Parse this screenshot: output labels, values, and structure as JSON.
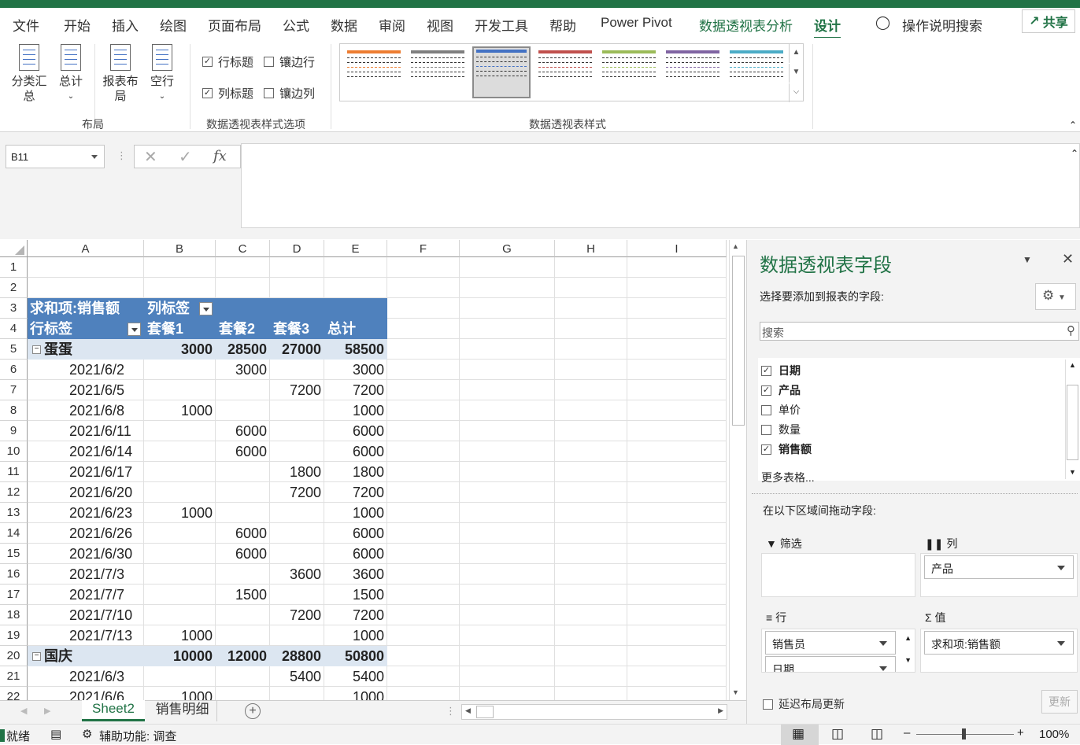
{
  "menu": {
    "tabs": [
      "文件",
      "开始",
      "插入",
      "绘图",
      "页面布局",
      "公式",
      "数据",
      "审阅",
      "视图",
      "开发工具",
      "帮助",
      "Power Pivot",
      "数据透视表分析",
      "设计"
    ],
    "tell_me": "操作说明搜索",
    "share": "共享"
  },
  "ribbon": {
    "subtotal": "分类汇总",
    "grand_total": "总计",
    "report_layout": "报表布局",
    "blank_rows": "空行",
    "group_layout": "布局",
    "row_headers": "行标题",
    "banded_rows": "镶边行",
    "col_headers": "列标题",
    "banded_cols": "镶边列",
    "group_options": "数据透视表样式选项",
    "group_styles": "数据透视表样式",
    "style_colors": [
      "#ed7d31",
      "#7f7f7f",
      "#4472c4",
      "#c0504d",
      "#9bbb59",
      "#8064a2",
      "#4bacc6"
    ]
  },
  "formula_bar": {
    "name_box": "B11",
    "fx": "fx",
    "value": ""
  },
  "grid": {
    "columns": [
      "A",
      "B",
      "C",
      "D",
      "E",
      "F",
      "G",
      "H",
      "I"
    ],
    "header_row": [
      "求和项:销售额",
      "列标签"
    ],
    "label_row": [
      "行标签",
      "套餐1",
      "套餐2",
      "套餐3",
      "总计"
    ],
    "rows": [
      {
        "n": "1",
        "cells": [
          "",
          "",
          "",
          "",
          ""
        ],
        "type": "empty"
      },
      {
        "n": "2",
        "cells": [
          "",
          "",
          "",
          "",
          ""
        ],
        "type": "empty"
      },
      {
        "n": "5",
        "cells": [
          "蛋蛋",
          "3000",
          "28500",
          "27000",
          "58500"
        ],
        "type": "group"
      },
      {
        "n": "6",
        "cells": [
          "2021/6/2",
          "",
          "3000",
          "",
          "3000"
        ],
        "type": "item"
      },
      {
        "n": "7",
        "cells": [
          "2021/6/5",
          "",
          "",
          "7200",
          "7200"
        ],
        "type": "item"
      },
      {
        "n": "8",
        "cells": [
          "2021/6/8",
          "1000",
          "",
          "",
          "1000"
        ],
        "type": "item"
      },
      {
        "n": "9",
        "cells": [
          "2021/6/11",
          "",
          "6000",
          "",
          "6000"
        ],
        "type": "item"
      },
      {
        "n": "10",
        "cells": [
          "2021/6/14",
          "",
          "6000",
          "",
          "6000"
        ],
        "type": "item"
      },
      {
        "n": "11",
        "cells": [
          "2021/6/17",
          "",
          "",
          "1800",
          "1800"
        ],
        "type": "item"
      },
      {
        "n": "12",
        "cells": [
          "2021/6/20",
          "",
          "",
          "7200",
          "7200"
        ],
        "type": "item"
      },
      {
        "n": "13",
        "cells": [
          "2021/6/23",
          "1000",
          "",
          "",
          "1000"
        ],
        "type": "item"
      },
      {
        "n": "14",
        "cells": [
          "2021/6/26",
          "",
          "6000",
          "",
          "6000"
        ],
        "type": "item"
      },
      {
        "n": "15",
        "cells": [
          "2021/6/30",
          "",
          "6000",
          "",
          "6000"
        ],
        "type": "item"
      },
      {
        "n": "16",
        "cells": [
          "2021/7/3",
          "",
          "",
          "3600",
          "3600"
        ],
        "type": "item"
      },
      {
        "n": "17",
        "cells": [
          "2021/7/7",
          "",
          "1500",
          "",
          "1500"
        ],
        "type": "item"
      },
      {
        "n": "18",
        "cells": [
          "2021/7/10",
          "",
          "",
          "7200",
          "7200"
        ],
        "type": "item"
      },
      {
        "n": "19",
        "cells": [
          "2021/7/13",
          "1000",
          "",
          "",
          "1000"
        ],
        "type": "item"
      },
      {
        "n": "20",
        "cells": [
          "国庆",
          "10000",
          "12000",
          "28800",
          "50800"
        ],
        "type": "group"
      },
      {
        "n": "21",
        "cells": [
          "2021/6/3",
          "",
          "",
          "5400",
          "5400"
        ],
        "type": "item"
      },
      {
        "n": "22",
        "cells": [
          "2021/6/6",
          "1000",
          "",
          "",
          "1000"
        ],
        "type": "item"
      }
    ]
  },
  "sheets": {
    "tabs": [
      "Sheet2",
      "销售明细"
    ],
    "active": "Sheet2"
  },
  "status": {
    "ready": "就绪",
    "accessibility": "辅助功能: 调查",
    "zoom": "100%"
  },
  "pane": {
    "title": "数据透视表字段",
    "choose": "选择要添加到报表的字段:",
    "search_placeholder": "搜索",
    "fields": [
      {
        "name": "日期",
        "checked": true
      },
      {
        "name": "产品",
        "checked": true
      },
      {
        "name": "单价",
        "checked": false
      },
      {
        "name": "数量",
        "checked": false
      },
      {
        "name": "销售额",
        "checked": true
      }
    ],
    "more_tables": "更多表格...",
    "drag_areas": "在以下区域间拖动字段:",
    "filter_label": "筛选",
    "columns_label": "列",
    "rows_label": "行",
    "values_label": "值",
    "columns_items": [
      "产品"
    ],
    "rows_items": [
      "销售员",
      "日期"
    ],
    "values_items": [
      "求和项:销售额"
    ],
    "defer": "延迟布局更新",
    "update": "更新"
  }
}
